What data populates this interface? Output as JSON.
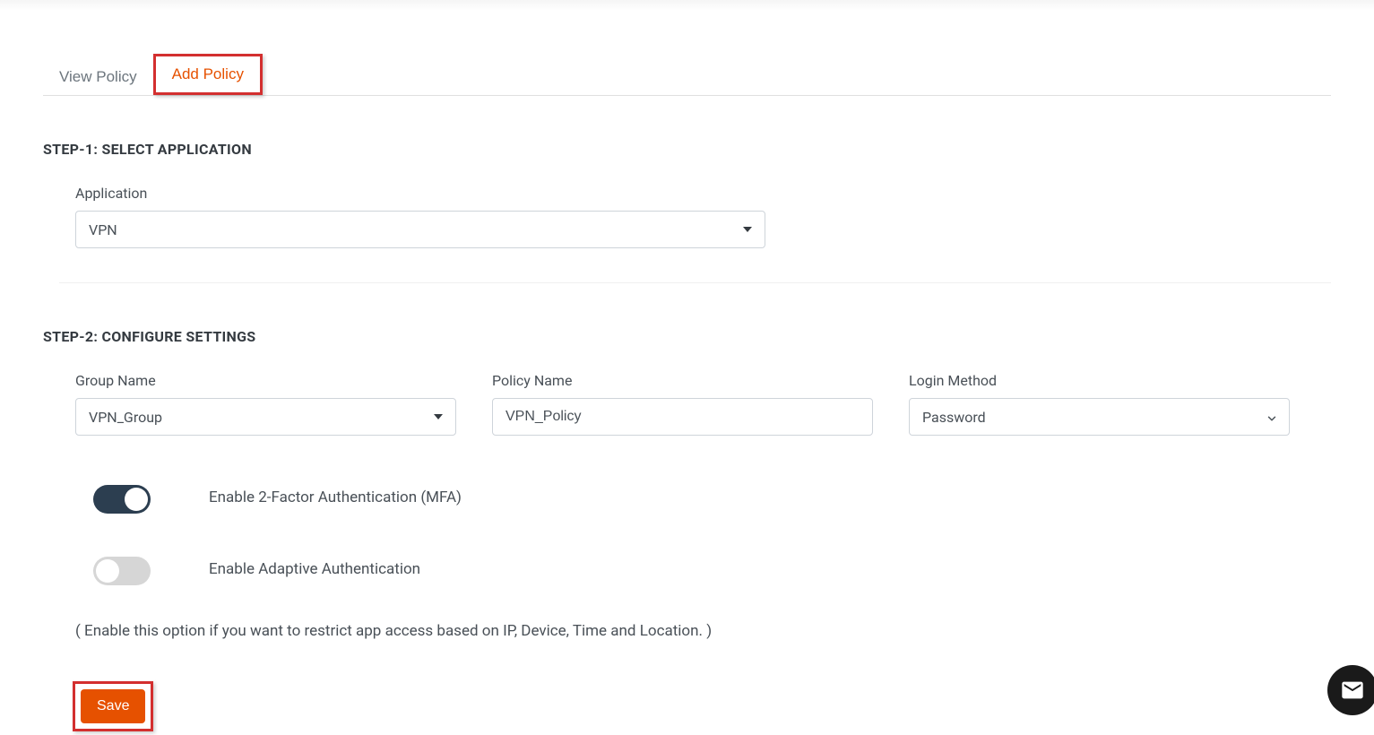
{
  "tabs": {
    "view": "View Policy",
    "add": "Add Policy"
  },
  "step1": {
    "heading": "STEP-1: SELECT APPLICATION",
    "application_label": "Application",
    "application_value": "VPN"
  },
  "step2": {
    "heading": "STEP-2: CONFIGURE SETTINGS",
    "group_name_label": "Group Name",
    "group_name_value": "VPN_Group",
    "policy_name_label": "Policy Name",
    "policy_name_value": "VPN_Policy",
    "login_method_label": "Login Method",
    "login_method_value": "Password",
    "mfa_label": "Enable 2-Factor Authentication (MFA)",
    "adaptive_label": "Enable Adaptive Authentication",
    "adaptive_description": "( Enable this option if you want to restrict app access based on IP, Device, Time and Location. )"
  },
  "actions": {
    "save": "Save"
  }
}
